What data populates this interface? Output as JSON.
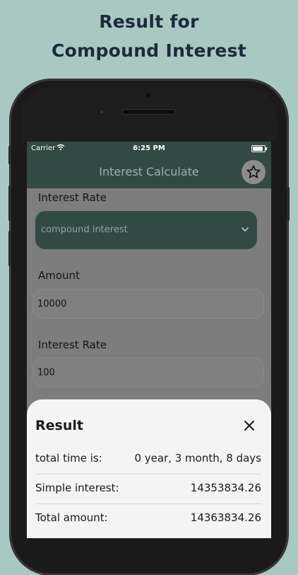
{
  "headline": {
    "line1": "Result for",
    "line2": "Compound Interest"
  },
  "status": {
    "carrier": "Carrier",
    "time": "6:25 PM"
  },
  "appbar": {
    "title": "Interest Calculate"
  },
  "form": {
    "type_label": "Interest Rate",
    "type_value": "compound interest",
    "amount_label": "Amount",
    "amount_value": "10000",
    "rate_label": "Interest Rate",
    "rate_value": "100"
  },
  "result": {
    "title": "Result",
    "rows": [
      {
        "label": "total time is:",
        "value": "0 year, 3 month, 8 days"
      },
      {
        "label": "Simple interest:",
        "value": "14353834.26"
      },
      {
        "label": "Total amount:",
        "value": "14363834.26"
      }
    ]
  },
  "colors": {
    "background": "#a9c8c2",
    "primary": "#324a43",
    "heading": "#1c2b3a"
  },
  "icons": [
    "wifi-icon",
    "battery-icon",
    "star-icon",
    "chevron-down-icon",
    "close-icon"
  ]
}
